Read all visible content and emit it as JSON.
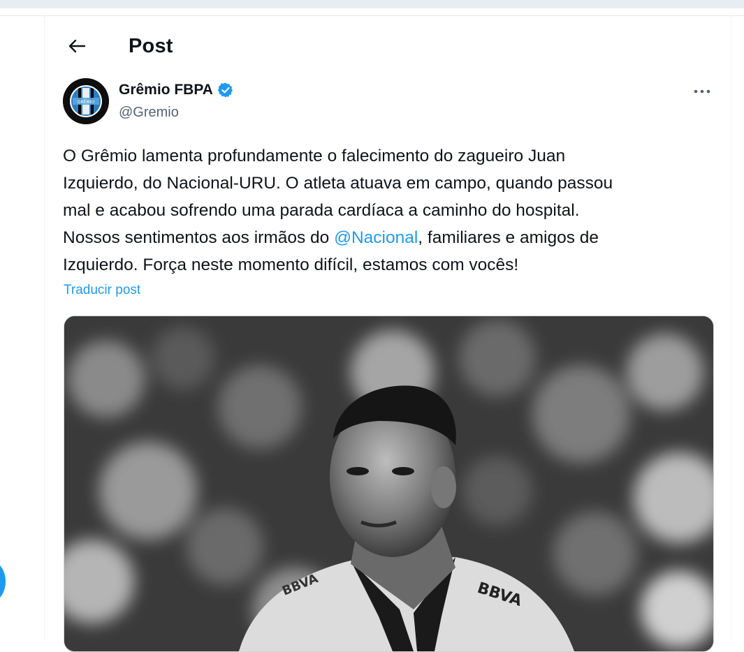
{
  "header": {
    "title": "Post"
  },
  "author": {
    "name": "Grêmio FBPA",
    "handle": "@Gremio",
    "verified": true,
    "avatar_text": "GRÊMIO"
  },
  "tweet": {
    "lines": [
      "O Grêmio lamenta profundamente o falecimento do zagueiro Juan",
      "Izquierdo, do Nacional-URU. O atleta atuava em campo, quando passou",
      "mal e acabou sofrendo uma parada cardíaca a caminho do hospital."
    ],
    "line4_before": "Nossos sentimentos aos irmãos do ",
    "mention": "@Nacional",
    "line4_after": ", familiares e amigos de",
    "line5": "Izquierdo. Força neste momento difícil, estamos com vocês!",
    "translate_label": "Traducir post"
  },
  "media": {
    "sponsor_text": "BBVA",
    "sponsor_text_left": "BBVA"
  },
  "colors": {
    "accent": "#1d9bf0",
    "text": "#0f1419",
    "secondary": "#536471"
  }
}
